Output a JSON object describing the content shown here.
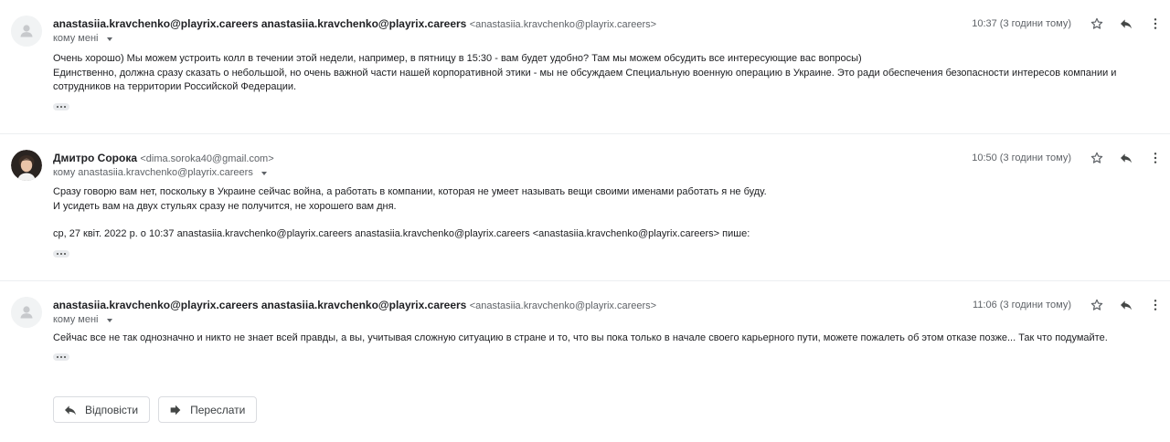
{
  "messages": [
    {
      "sender_name": "anastasiia.kravchenko@playrix.careers anastasiia.kravchenko@playrix.careers",
      "sender_email": "<anastasiia.kravchenko@playrix.careers>",
      "to_label": "кому мені",
      "time": "10:37 (3 години тому)",
      "avatar": "default-avatar-icon",
      "body_lines": [
        "Очень хорошо) Мы можем устроить колл в течении этой недели, например, в пятницу в 15:30 - вам будет удобно? Там мы можем обсудить все интересующие вас вопросы)",
        "Единственно, должна сразу сказать о небольшой, но очень важной части нашей корпоративной этики - мы не обсуждаем Специальную военную операцию в Украине. Это ради обеспечения безопасности интересов компании и сотрудников на территории Российской Федерации."
      ]
    },
    {
      "sender_name": "Дмитро Сорока",
      "sender_email": "<dima.soroka40@gmail.com>",
      "to_label": "кому anastasiia.kravchenko@playrix.careers",
      "time": "10:50 (3 години тому)",
      "avatar": "profile-photo",
      "body_lines": [
        "Сразу говорю вам нет, поскольку в Украине сейчас война, а работать в компании, которая не умеет называть вещи своими именами работать я не буду.",
        "И усидеть вам на двух стульях сразу не получится, не хорошего вам дня."
      ],
      "quote_header": "ср, 27 квіт. 2022 р. о 10:37 anastasiia.kravchenko@playrix.careers anastasiia.kravchenko@playrix.careers <anastasiia.kravchenko@playrix.careers> пише:"
    },
    {
      "sender_name": "anastasiia.kravchenko@playrix.careers anastasiia.kravchenko@playrix.careers",
      "sender_email": "<anastasiia.kravchenko@playrix.careers>",
      "to_label": "кому мені",
      "time": "11:06 (3 години тому)",
      "avatar": "default-avatar-icon",
      "body_lines": [
        "Сейчас все не так однозначно и никто не знает всей правды, а вы, учитывая сложную ситуацию в стране и то, что вы пока только в начале своего карьерного пути, можете пожалеть об этом отказе позже... Так что подумайте."
      ]
    }
  ],
  "actions": {
    "reply_label": "Відповісти",
    "forward_label": "Переслати"
  },
  "icons": {
    "star": "star-icon",
    "reply": "reply-icon",
    "more": "more-vert-icon",
    "forward": "forward-icon"
  },
  "colors": {
    "text": "#202124",
    "muted": "#5f6368",
    "divider": "#eceff1",
    "button_border": "#dadce0"
  }
}
